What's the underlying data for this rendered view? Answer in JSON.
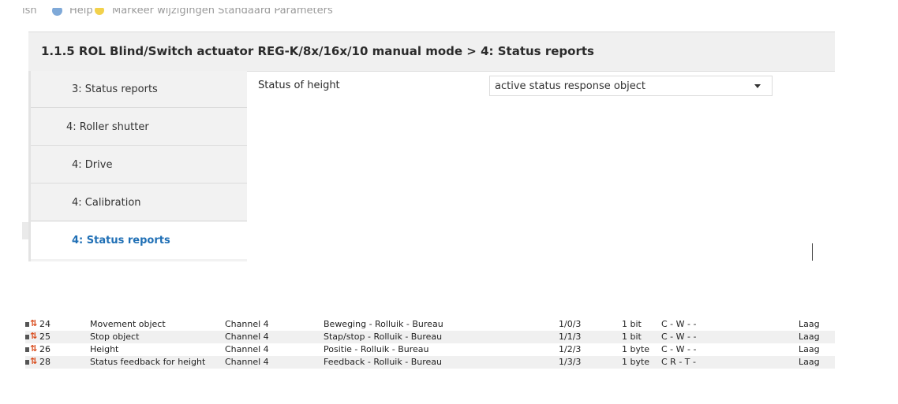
{
  "menubar": {
    "left_fragment": "ish",
    "help_label": "Help",
    "mode_label": "Markeer wijzigingen   Standaard Parameters"
  },
  "header": {
    "title": "1.1.5 ROL Blind/Switch actuator REG-K/8x/16x/10 manual mode >   4: Status reports"
  },
  "nav": {
    "items": [
      {
        "label": "3: Status reports",
        "active": false
      },
      {
        "label": "4: Roller shutter",
        "active": false
      },
      {
        "label": "4: Drive",
        "active": false
      },
      {
        "label": "4: Calibration",
        "active": false
      },
      {
        "label": "4: Status reports",
        "active": true
      }
    ]
  },
  "params": {
    "status_of_height_label": "Status of height",
    "status_of_height_value": "active status response object"
  },
  "colors": {
    "accent": "#1f6fb5",
    "icon_arrow": "#d94a1a"
  },
  "objects": {
    "rows": [
      {
        "number": "24",
        "name": "Movement object",
        "channel": "Channel 4",
        "group": "Beweging - Rolluik - Bureau",
        "address": "1/0/3",
        "size": "1 bit",
        "flags": "C  -  W  -  -",
        "priority": "Laag"
      },
      {
        "number": "25",
        "name": "Stop object",
        "channel": "Channel 4",
        "group": "Stap/stop - Rolluik - Bureau",
        "address": "1/1/3",
        "size": "1 bit",
        "flags": "C  -  W  -  -",
        "priority": "Laag"
      },
      {
        "number": "26",
        "name": "Height",
        "channel": "Channel 4",
        "group": "Positie - Rolluik - Bureau",
        "address": "1/2/3",
        "size": "1 byte",
        "flags": "C  -  W  -  -",
        "priority": "Laag"
      },
      {
        "number": "28",
        "name": "Status feedback for height",
        "channel": "Channel 4",
        "group": "Feedback - Rolluik - Bureau",
        "address": "1/3/3",
        "size": "1 byte",
        "flags": "C  R  -  T  -",
        "priority": "Laag"
      }
    ]
  }
}
